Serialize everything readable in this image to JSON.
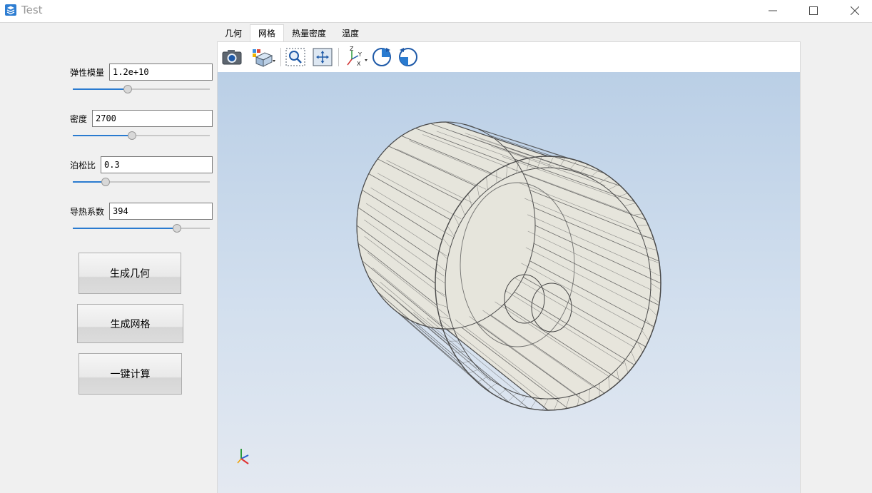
{
  "window": {
    "title": "Test"
  },
  "left_panel": {
    "params": [
      {
        "label": "弹性模量",
        "value": "1.2e+10",
        "slider_fraction": 0.4
      },
      {
        "label": "密度",
        "value": "2700",
        "slider_fraction": 0.43
      },
      {
        "label": "泊松比",
        "value": "0.3",
        "slider_fraction": 0.24
      },
      {
        "label": "导热系数",
        "value": "394",
        "slider_fraction": 0.76
      }
    ],
    "buttons": {
      "generate_geometry": "生成几何",
      "generate_mesh": "生成网格",
      "compute": "一键计算"
    }
  },
  "tabs": [
    {
      "label": "几何",
      "active": false
    },
    {
      "label": "网格",
      "active": true
    },
    {
      "label": "热量密度",
      "active": false
    },
    {
      "label": "温度",
      "active": false
    }
  ],
  "toolbar": {
    "tools": [
      "camera-icon",
      "view-cube-icon",
      "zoom-box-icon",
      "fit-all-icon",
      "axes-icon",
      "rotate-cw-icon",
      "rotate-ccw-icon"
    ],
    "axis_letters": {
      "x": "X",
      "y": "Y",
      "z": "Z"
    }
  },
  "colors": {
    "accent": "#2a7bd0",
    "viewport_top": "#bacfe6",
    "viewport_bottom": "#e4e9f1",
    "mesh_line": "#4a4a4a",
    "mesh_fill": "#e8e6dc"
  }
}
